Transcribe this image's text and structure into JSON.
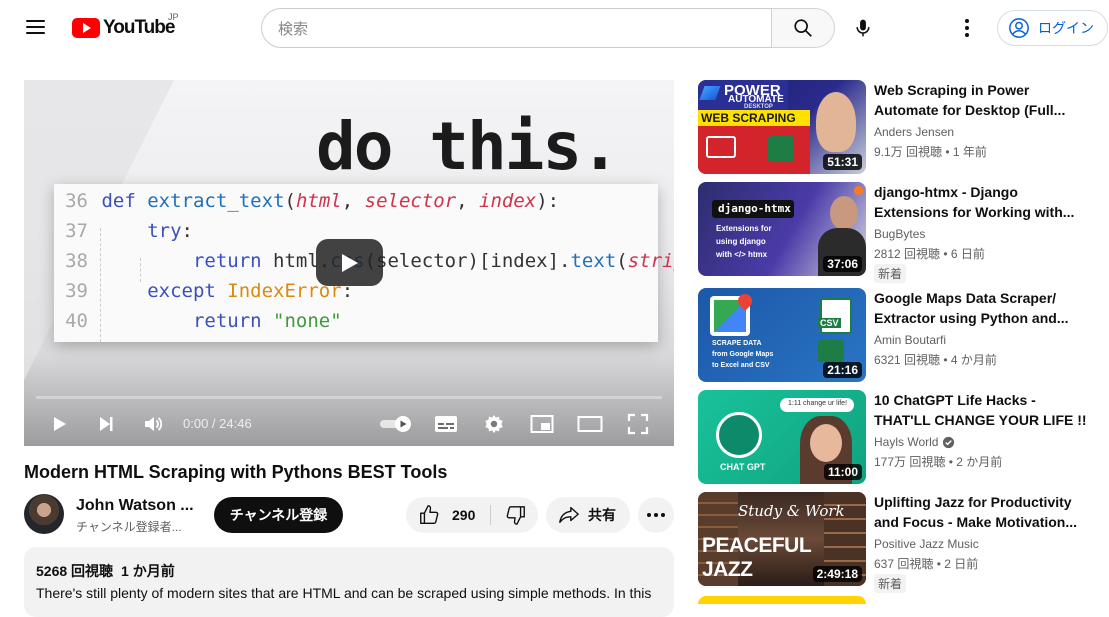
{
  "masthead": {
    "logo_text": "YouTube",
    "logo_region": "JP",
    "search_placeholder": "検索",
    "login_label": "ログイン"
  },
  "player": {
    "headline": "do this.",
    "code_lines": [
      {
        "num": "36"
      },
      {
        "num": "37"
      },
      {
        "num": "38"
      },
      {
        "num": "39"
      },
      {
        "num": "40"
      }
    ],
    "time": "0:00 / 24:46",
    "progress": 0
  },
  "video": {
    "title": "Modern HTML Scraping with Pythons BEST Tools",
    "channel": "John Watson ...",
    "subscribers": "チャンネル登録者...",
    "subscribe_label": "チャンネル登録",
    "likes": "290",
    "share_label": "共有",
    "views": "5268 回視聴",
    "published": "1 か月前",
    "description": "There's still plenty of modern sites that are HTML and can be scraped using simple methods. In this"
  },
  "recommendations": [
    {
      "title_1": "Web Scraping in Power",
      "title_2": "Automate for Desktop (Full...",
      "channel": "Anders Jensen",
      "meta": "9.1万 回視聴 • 1 年前",
      "duration": "51:31",
      "thumb_line1": "POWER",
      "thumb_line2": "AUTOMATE",
      "thumb_line3": "DESKTOP",
      "thumb_line4": "WEB SCRAPING"
    },
    {
      "title_1": "django-htmx - Django",
      "title_2": "Extensions for Working with...",
      "channel": "BugBytes",
      "meta": "2812 回視聴 • 6 日前",
      "badge": "新着",
      "duration": "37:06",
      "thumb_line1": "django-htmx",
      "thumb_line2": "Extensions for",
      "thumb_line3": "using django",
      "thumb_line4": "with </> htmx"
    },
    {
      "title_1": "Google Maps Data Scraper/",
      "title_2": "Extractor using Python and...",
      "channel": "Amin Boutarfi",
      "meta": "6321 回視聴 • 4 か月前",
      "duration": "21:16",
      "thumb_line1": "SCRAPE DATA",
      "thumb_line2": "from Google Maps",
      "thumb_line3": "to Excel and CSV",
      "thumb_line4": "CSV"
    },
    {
      "title_1": "10 ChatGPT Life Hacks -",
      "title_2": "THAT'LL CHANGE YOUR LIFE !!",
      "channel": "Hayls World",
      "meta": "177万 回視聴 • 2 か月前",
      "duration": "11:00",
      "thumb_line1": "CHAT GPT",
      "thumb_line2": "1:11 change ur life!"
    },
    {
      "title_1": "Uplifting Jazz for Productivity",
      "title_2": "and Focus - Make Motivation...",
      "channel": "Positive Jazz Music",
      "meta": "637 回視聴 • 2 日前",
      "badge": "新着",
      "duration": "2:49:18",
      "thumb_line1": "Study & Work",
      "thumb_line2": "PEACEFUL JAZZ"
    }
  ],
  "colors": {
    "brand_red": "#ff0000",
    "link_blue": "#065fd4",
    "text_primary": "#0f0f0f",
    "text_secondary": "#606060"
  }
}
